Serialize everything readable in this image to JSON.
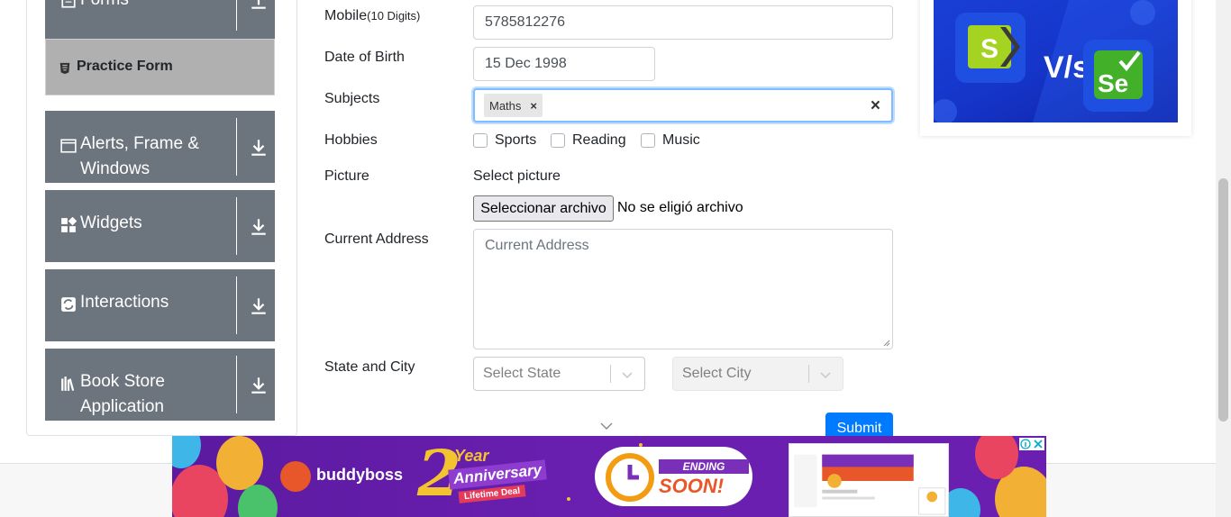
{
  "sidebar": {
    "forms_label": "Forms",
    "practice_form_label": "Practice Form",
    "groups": [
      {
        "label_line1": "Alerts, Frame &",
        "label_line2": "Windows"
      },
      {
        "label_line1": "Widgets",
        "label_line2": ""
      },
      {
        "label_line1": "Interactions",
        "label_line2": ""
      },
      {
        "label_line1": "Book Store",
        "label_line2": "Application"
      }
    ]
  },
  "form": {
    "mobile_label": "Mobile",
    "mobile_hint": "(10 Digits)",
    "mobile_value": "5785812276",
    "dob_label": "Date of Birth",
    "dob_value": "15 Dec 1998",
    "subjects_label": "Subjects",
    "subjects_chip": "Maths",
    "chip_remove": "×",
    "clear_all": "×",
    "hobbies_label": "Hobbies",
    "hobbies": [
      "Sports",
      "Reading",
      "Music"
    ],
    "picture_label": "Picture",
    "select_picture": "Select picture",
    "file_button": "Seleccionar archivo",
    "file_status": "No se eligió archivo",
    "address_label": "Current Address",
    "address_placeholder": "Current Address",
    "state_city_label": "State and City",
    "state_placeholder": "Select State",
    "city_placeholder": "Select City",
    "submit_label": "Submit"
  },
  "banner": {
    "brand": "buddyboss",
    "anniv_number": "2",
    "anniv_year": "Year",
    "anniv_text": "Anniversary",
    "anniv_deal": "Lifetime Deal",
    "soon_top": "ENDING",
    "soon_bottom": "SOON!"
  },
  "colors": {
    "sidebar_group": "#6c757d",
    "active_item": "#b0b0b0",
    "focus_border": "#80bdff",
    "submit": "#007bff",
    "banner_bg": "#5b1aa0"
  }
}
